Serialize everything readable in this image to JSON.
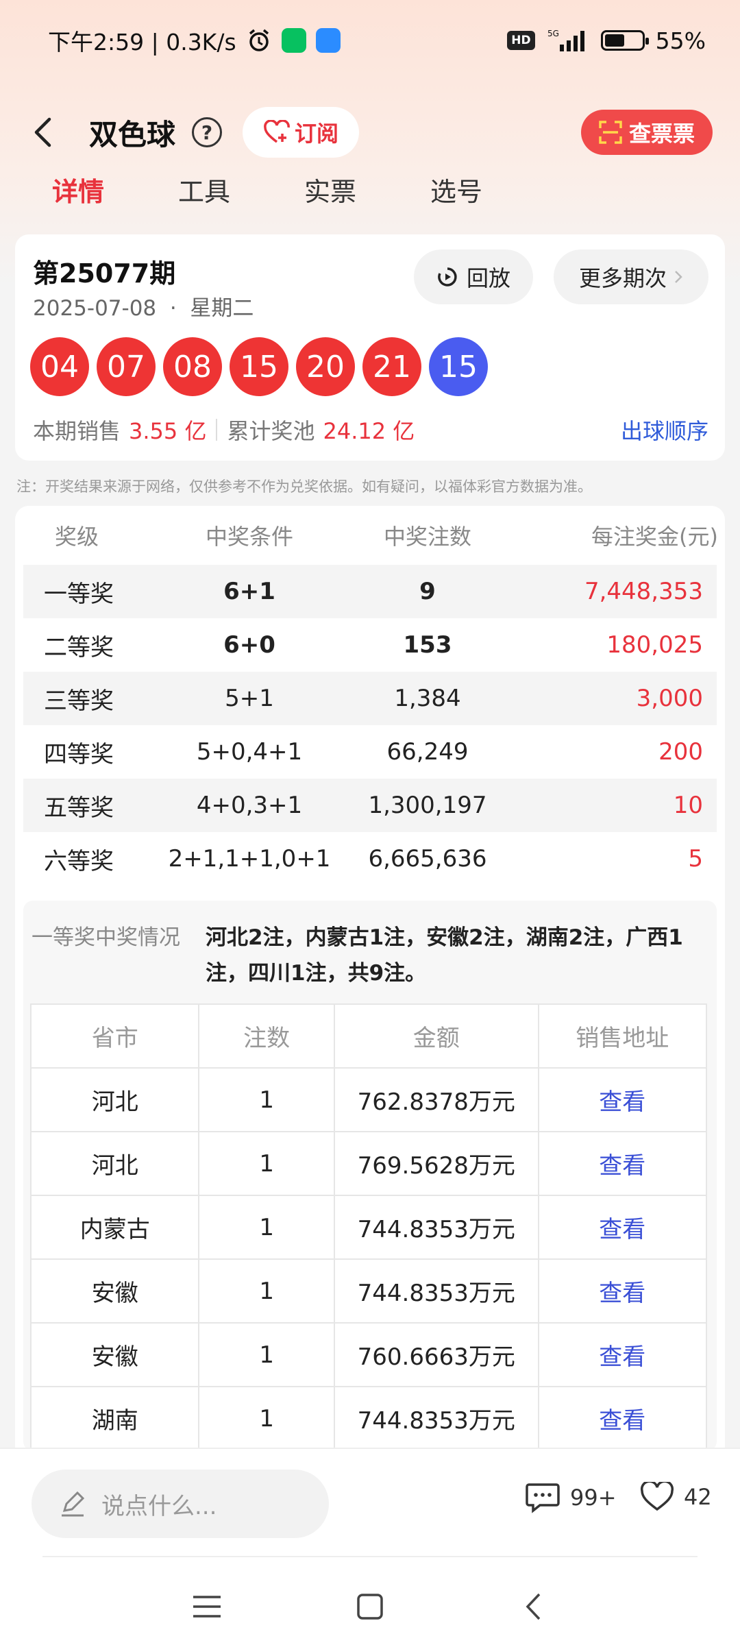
{
  "status_bar": {
    "time": "下午2:59 | 0.3K/s",
    "hd": "HD",
    "signal": "5G",
    "battery": "55%",
    "battery_level": 0.55
  },
  "header": {
    "title": "双色球",
    "help": "?",
    "subscribe_label": "订阅",
    "check_ticket_label": "查票票"
  },
  "tabs": [
    "详情",
    "工具",
    "实票",
    "选号"
  ],
  "draw": {
    "issue": "第25077期",
    "date": "2025-07-08  ·  星期二",
    "replay_label": "回放",
    "more_label": "更多期次",
    "red_balls": [
      "04",
      "07",
      "08",
      "15",
      "20",
      "21"
    ],
    "blue_ball": "15",
    "sales_label": "本期销售",
    "sales_value": "3.55 亿",
    "pool_label": "累计奖池",
    "pool_value": "24.12 亿",
    "order_link": "出球顺序"
  },
  "note": "注：开奖结果来源于网络，仅供参考不作为兑奖依据。如有疑问，以福体彩官方数据为准。",
  "prize_table": {
    "headers": [
      "奖级",
      "中奖条件",
      "中奖注数",
      "每注奖金(元)"
    ],
    "rows": [
      {
        "level": "一等奖",
        "condition": "6+1",
        "count": "9",
        "amount": "7,448,353"
      },
      {
        "level": "二等奖",
        "condition": "6+0",
        "count": "153",
        "amount": "180,025"
      },
      {
        "level": "三等奖",
        "condition": "5+1",
        "count": "1,384",
        "amount": "3,000"
      },
      {
        "level": "四等奖",
        "condition": "5+0,4+1",
        "count": "66,249",
        "amount": "200"
      },
      {
        "level": "五等奖",
        "condition": "4+0,3+1",
        "count": "1,300,197",
        "amount": "10"
      },
      {
        "level": "六等奖",
        "condition": "2+1,1+1,0+1",
        "count": "6,665,636",
        "amount": "5"
      }
    ]
  },
  "winners": {
    "label": "一等奖中奖情况",
    "summary": "河北2注，内蒙古1注，安徽2注，湖南2注，广西1注，四川1注，共9注。",
    "headers": [
      "省市",
      "注数",
      "金额",
      "销售地址"
    ],
    "rows": [
      {
        "province": "河北",
        "count": "1",
        "amount": "762.8378万元",
        "link": "查看"
      },
      {
        "province": "河北",
        "count": "1",
        "amount": "769.5628万元",
        "link": "查看"
      },
      {
        "province": "内蒙古",
        "count": "1",
        "amount": "744.8353万元",
        "link": "查看"
      },
      {
        "province": "安徽",
        "count": "1",
        "amount": "744.8353万元",
        "link": "查看"
      },
      {
        "province": "安徽",
        "count": "1",
        "amount": "760.6663万元",
        "link": "查看"
      },
      {
        "province": "湖南",
        "count": "1",
        "amount": "744.8353万元",
        "link": "查看"
      }
    ]
  },
  "bottom": {
    "comment_placeholder": "说点什么...",
    "comment_count": "99+",
    "like_count": "42"
  },
  "colors": {
    "accent_red": "#e8323c",
    "ball_red": "#ee3434",
    "ball_blue": "#4a5cf0",
    "link_blue": "#2f5bd9"
  }
}
